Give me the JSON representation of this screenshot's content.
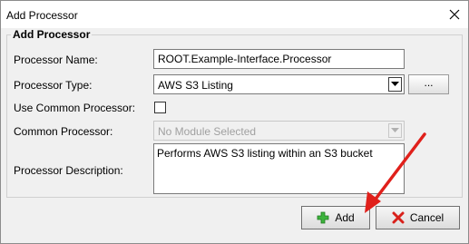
{
  "window": {
    "title": "Add Processor",
    "close_icon": "close-icon"
  },
  "group": {
    "title": "Add Processor"
  },
  "form": {
    "processor_name": {
      "label": "Processor Name:",
      "value": "ROOT.Example-Interface.Processor"
    },
    "processor_type": {
      "label": "Processor Type:",
      "value": "AWS S3 Listing",
      "browse_label": "..."
    },
    "use_common_processor": {
      "label": "Use Common Processor:",
      "checked": false
    },
    "common_processor": {
      "label": "Common Processor:",
      "value": "No Module Selected",
      "disabled": true
    },
    "processor_description": {
      "label": "Processor Description:",
      "value": "Performs AWS S3 listing within an S3 bucket"
    }
  },
  "buttons": {
    "add": {
      "label": "Add",
      "icon": "plus-icon"
    },
    "cancel": {
      "label": "Cancel",
      "icon": "x-icon"
    }
  },
  "annotation": {
    "arrow_color": "#e0201b"
  }
}
